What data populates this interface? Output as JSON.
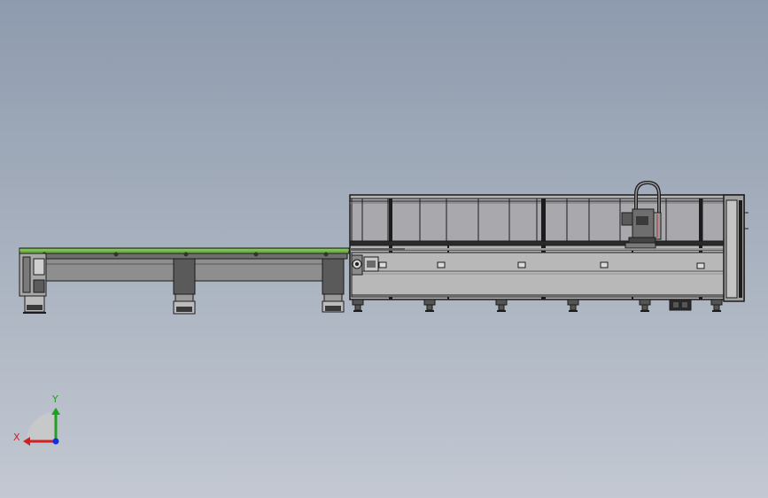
{
  "viewport": {
    "background_top": "#8e9bae",
    "background_bottom": "#c3c8d2"
  },
  "triad": {
    "x_label": "X",
    "y_label": "Y",
    "x_color": "#d02020",
    "y_color": "#20a020",
    "z_color": "#1030e0"
  },
  "model": {
    "conveyor_top_color": "#6bb042",
    "frame_color": "#1c1c1c",
    "panel_color": "#b4b4b4"
  }
}
